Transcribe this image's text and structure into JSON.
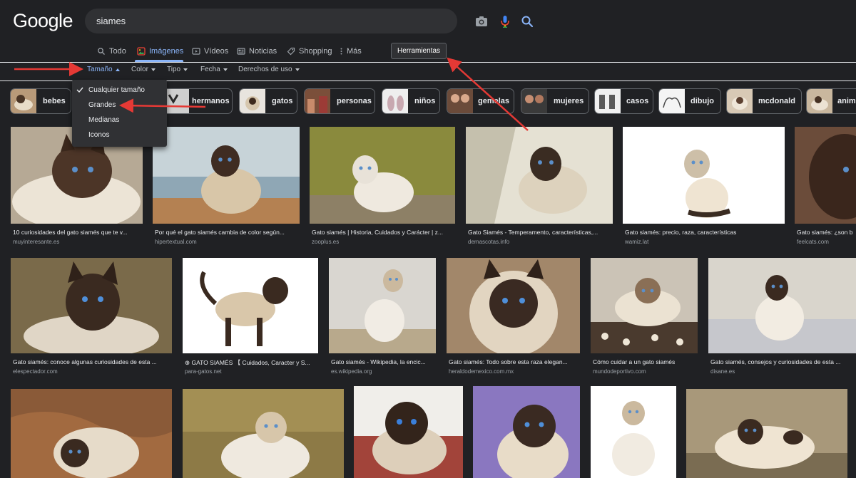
{
  "header": {
    "logo": "Google",
    "search_value": "siames",
    "icons": [
      "camera-icon",
      "microphone-icon",
      "search-icon"
    ]
  },
  "tabs": [
    {
      "label": "Todo",
      "icon": "search-icon"
    },
    {
      "label": "Imágenes",
      "icon": "image-icon",
      "active": true
    },
    {
      "label": "Vídeos",
      "icon": "video-icon"
    },
    {
      "label": "Noticias",
      "icon": "news-icon"
    },
    {
      "label": "Shopping",
      "icon": "tag-icon"
    },
    {
      "label": "Más",
      "icon": "more-vert-icon"
    }
  ],
  "tools_label": "Herramientas",
  "filters": [
    {
      "label": "Tamaño",
      "open": true
    },
    {
      "label": "Color"
    },
    {
      "label": "Tipo"
    },
    {
      "label": "Fecha"
    },
    {
      "label": "Derechos de uso"
    }
  ],
  "size_menu": {
    "items": [
      "Cualquier tamaño",
      "Grandes",
      "Medianas",
      "Iconos"
    ],
    "selected": "Cualquier tamaño"
  },
  "chips": [
    "bebes",
    "hermanos",
    "gatos",
    "personas",
    "niños",
    "gemelas",
    "mujeres",
    "casos",
    "dibujo",
    "mcdonald",
    "anima"
  ],
  "results": [
    {
      "caption": "10 curiosidades del gato siamés que te v...",
      "source": "muyinteresante.es"
    },
    {
      "caption": "Por qué el gato siamés cambia de color según...",
      "source": "hipertextual.com"
    },
    {
      "caption": "Gato siamés | Historia, Cuidados y Carácter | z...",
      "source": "zooplus.es"
    },
    {
      "caption": "Gato Siamés - Temperamento, características,...",
      "source": "demascotas.info"
    },
    {
      "caption": "Gato siamés: precio, raza, características",
      "source": "wamiz.lat"
    },
    {
      "caption": "Gato siamés: ¿son b",
      "source": "feelcats.com"
    },
    {
      "caption": "Gato siamés: conoce algunas curiosidades de esta ...",
      "source": "elespectador.com"
    },
    {
      "caption": "⊕ GATO SIAMÉS 【 Cuidados, Caracter y S...",
      "source": "para-gatos.net"
    },
    {
      "caption": "Gato siamés - Wikipedia, la encic...",
      "source": "es.wikipedia.org"
    },
    {
      "caption": "Gato siamés: Todo sobre esta raza elegan...",
      "source": "heraldodemexico.com.mx"
    },
    {
      "caption": "Cómo cuidar a un gato siamés",
      "source": "mundodeportivo.com"
    },
    {
      "caption": "Gato siamés, consejos y curiosidades de esta ...",
      "source": "disane.es"
    }
  ],
  "colors": {
    "background": "#202124",
    "search_box": "#303134",
    "accent": "#8ab4f8",
    "annotation_arrow": "#e53935"
  }
}
